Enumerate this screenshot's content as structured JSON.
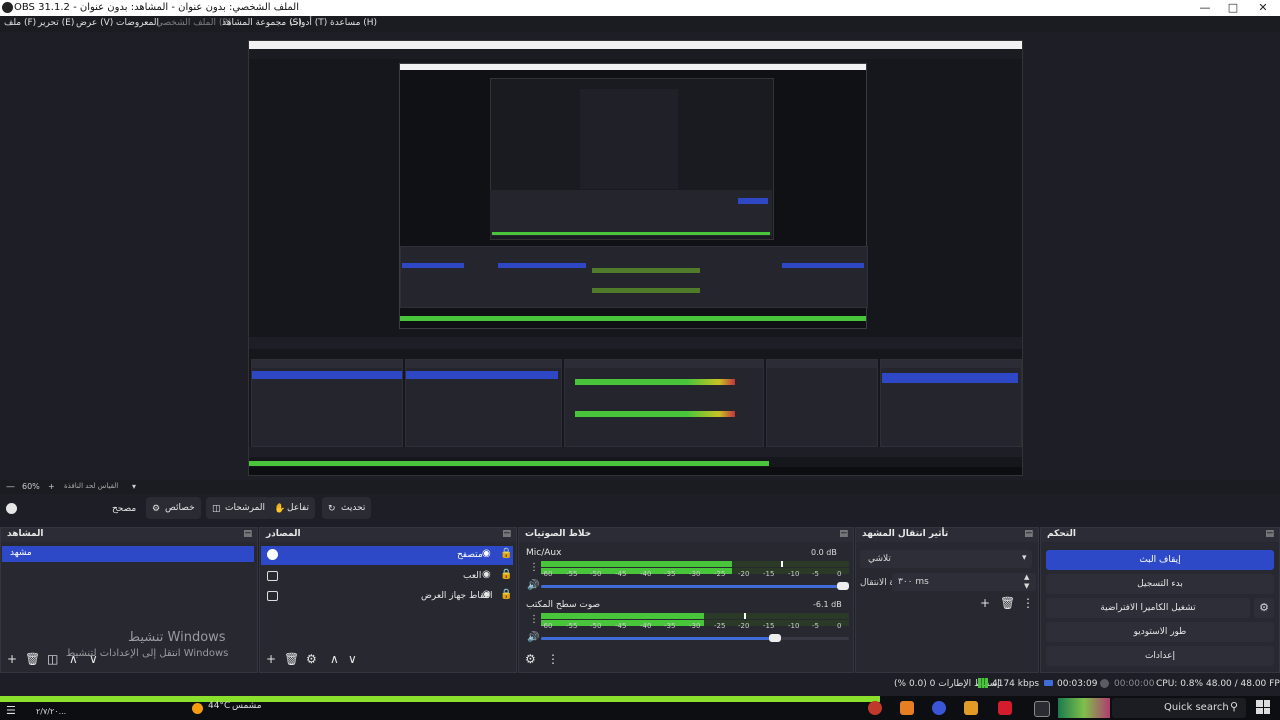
{
  "window": {
    "title": "OBS 31.1.2 - الملف الشخصي: بدون عنوان - المشاهد: بدون عنوان"
  },
  "menu": {
    "file": "ملف (F)",
    "edit": "تحرير (E)",
    "view": "عرض (V)",
    "docks": "المعروضات",
    "profile": "الملف الشخصي (P)",
    "scene_collection": "مجموعة المشاهد (S)",
    "tools": "أدوات (T)",
    "help": "مساعدة (H)"
  },
  "zoom": {
    "value": "60%",
    "mode": "القياس لحد النافذة"
  },
  "toolbar": {
    "studio_mode_label": "مصحح",
    "properties_label": "خصائص",
    "filters_label": "المرشحات",
    "interact_label": "تفاعل",
    "refresh_label": "تحديث"
  },
  "scenes": {
    "title": "المشاهد",
    "items": [
      "مشهد"
    ]
  },
  "sources": {
    "title": "المصادر",
    "items": [
      "متصفح",
      "العب",
      "التقاط جهاز العرض"
    ]
  },
  "mixer": {
    "title": "خلاط الصوتيات",
    "channels": [
      {
        "name": "Mic/Aux",
        "db": "0.0 dB",
        "level": 0.62,
        "peak": 0.78,
        "volume": 0.98
      },
      {
        "name": "صوت سطح المكتب",
        "db": "-6.1 dB",
        "level": 0.53,
        "peak": 0.66,
        "volume": 0.76
      }
    ],
    "ticks": [
      "-60",
      "-55",
      "-50",
      "-45",
      "-40",
      "-35",
      "-30",
      "-25",
      "-20",
      "-15",
      "-10",
      "-5",
      "0"
    ]
  },
  "transitions": {
    "title": "تأثير انتقال المشهد",
    "type": "تلاشي",
    "duration_label": "مدة الانتقال",
    "duration": "٣٠٠ ms"
  },
  "controls": {
    "title": "التحكم",
    "start_streaming": "إيقاف البث",
    "start_recording": "بدء التسجيل",
    "virtual_camera": "تشغيل الكاميرا الافتراضية",
    "studio_mode": "طور الاستوديو",
    "settings": "إعدادات"
  },
  "status": {
    "dropped": "إسقاط الإطارات 0 (0.0 %)",
    "bitrate": "4174 kbps",
    "stream_time": "00:03:09",
    "rec_time": "00:00:00",
    "cpu": "CPU: 0.8%",
    "fps": "48.00 / 48.00 FPS"
  },
  "watermark": {
    "line1": "تنشيط Windows",
    "line2": "انتقل إلى الإعدادات لتنشيط Windows"
  },
  "taskbar": {
    "weather_temp": "44°C",
    "weather_label": "مشمس",
    "search_placeholder": "Quick search",
    "clock": "٢/٧/٢٠..."
  },
  "colors": {
    "accent": "#2e49c8",
    "meter_green": "#48c53a",
    "meter_yellow": "#c9c325",
    "meter_red": "#c2343b"
  }
}
